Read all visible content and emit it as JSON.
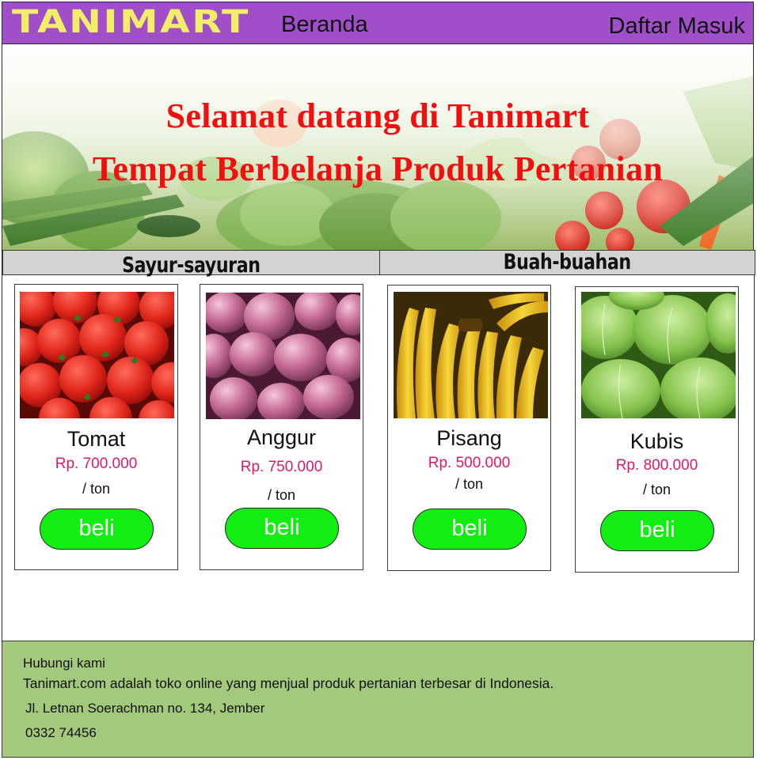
{
  "header": {
    "logo_text": "TANIMART",
    "nav_home": "Beranda",
    "nav_login": "Daftar Masuk",
    "colors": {
      "bar": "#a04fc8",
      "logo": "#f3ee6a"
    }
  },
  "hero": {
    "line1": "Selamat datang di Tanimart",
    "line2": "Tempat Berbelanja Produk Pertanian",
    "colors": {
      "text": "#f01010"
    },
    "background": "vegetables-banner-image"
  },
  "categories": [
    {
      "label": "Sayur-sayuran"
    },
    {
      "label": "Buah-buahan"
    }
  ],
  "products": [
    {
      "name": "Tomat",
      "price": "Rp. 700.000",
      "unit": "/ ton",
      "button": "beli",
      "image": "tomato-photo"
    },
    {
      "name": "Anggur",
      "price": "Rp. 750.000",
      "unit": "/ ton",
      "button": "beli",
      "image": "grape-photo"
    },
    {
      "name": "Pisang",
      "price": "Rp. 500.000",
      "unit": "/ ton",
      "button": "beli",
      "image": "banana-photo"
    },
    {
      "name": "Kubis",
      "price": "Rp. 800.000",
      "unit": "/ ton",
      "button": "beli",
      "image": "cabbage-photo"
    }
  ],
  "colors": {
    "price": "#e0186c",
    "buy_button": "#12ee12",
    "footer": "#a3c97c"
  },
  "footer": {
    "heading": "Hubungi kami",
    "description": "Tanimart.com adalah toko online yang menjual produk pertanian terbesar di Indonesia.",
    "address": "Jl. Letnan Soerachman no. 134, Jember",
    "phone": "0332 74456"
  }
}
